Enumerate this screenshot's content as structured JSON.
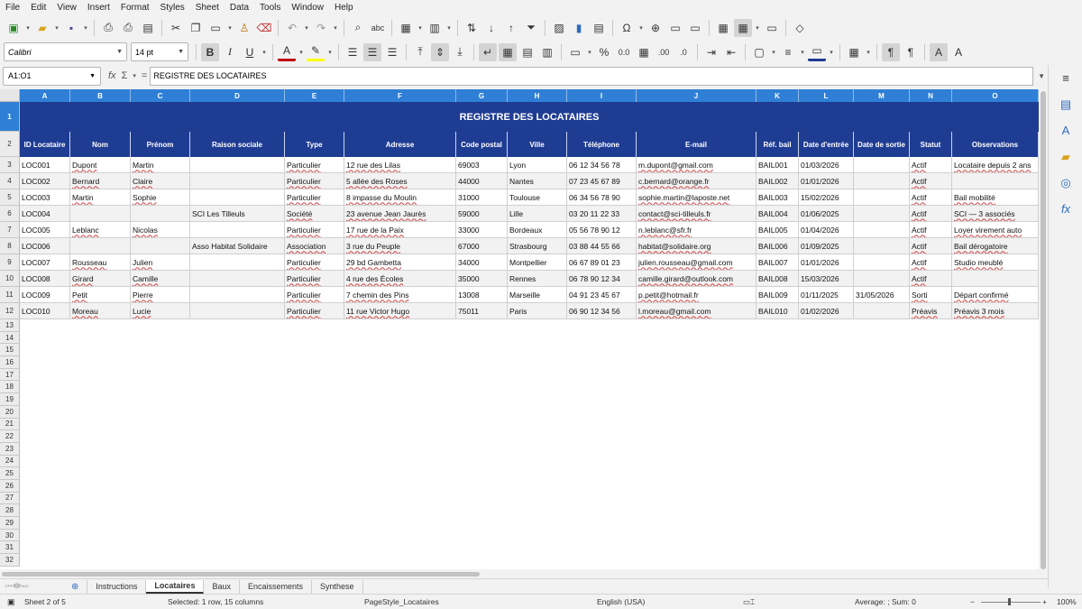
{
  "menu": [
    "File",
    "Edit",
    "View",
    "Insert",
    "Format",
    "Styles",
    "Sheet",
    "Data",
    "Tools",
    "Window",
    "Help"
  ],
  "toolbar": {
    "font_name": "Calibri",
    "font_size": "14 pt"
  },
  "formula_bar": {
    "name_box": "A1:O1",
    "fx_label": "fx",
    "sigma_label": "Σ",
    "equals_label": "=",
    "content": "REGISTRE DES LOCATAIRES"
  },
  "columns": [
    "A",
    "B",
    "C",
    "D",
    "E",
    "F",
    "G",
    "H",
    "I",
    "J",
    "K",
    "L",
    "M",
    "N",
    "O"
  ],
  "title": "REGISTRE DES LOCATAIRES",
  "headers": [
    "ID Locataire",
    "Nom",
    "Prénom",
    "Raison sociale",
    "Type",
    "Adresse",
    "Code postal",
    "Ville",
    "Téléphone",
    "E-mail",
    "Réf. bail",
    "Date d'entrée",
    "Date de sortie",
    "Statut",
    "Observations"
  ],
  "rows": [
    [
      "LOC001",
      "Dupont",
      "Martin",
      "",
      "Particulier",
      "12 rue des Lilas",
      "69003",
      "Lyon",
      "06 12 34 56 78",
      "m.dupont@gmail.com",
      "BAIL001",
      "01/03/2026",
      "",
      "Actif",
      "Locataire depuis 2 ans"
    ],
    [
      "LOC002",
      "Bernard",
      "Claire",
      "",
      "Particulier",
      "5 allée des Roses",
      "44000",
      "Nantes",
      "07 23 45 67 89",
      "c.bernard@orange.fr",
      "BAIL002",
      "01/01/2026",
      "",
      "Actif",
      ""
    ],
    [
      "LOC003",
      "Martin",
      "Sophie",
      "",
      "Particulier",
      "8 impasse du Moulin",
      "31000",
      "Toulouse",
      "06 34 56 78 90",
      "sophie.martin@laposte.net",
      "BAIL003",
      "15/02/2026",
      "",
      "Actif",
      "Bail mobilité"
    ],
    [
      "LOC004",
      "",
      "",
      "SCI Les Tilleuls",
      "Société",
      "23 avenue Jean Jaurès",
      "59000",
      "Lille",
      "03 20 11 22 33",
      "contact@sci-tilleuls.fr",
      "BAIL004",
      "01/06/2025",
      "",
      "Actif",
      "SCI — 3 associés"
    ],
    [
      "LOC005",
      "Leblanc",
      "Nicolas",
      "",
      "Particulier",
      "17 rue de la Paix",
      "33000",
      "Bordeaux",
      "05 56 78 90 12",
      "n.leblanc@sfr.fr",
      "BAIL005",
      "01/04/2026",
      "",
      "Actif",
      "Loyer virement auto"
    ],
    [
      "LOC006",
      "",
      "",
      "Asso Habitat Solidaire",
      "Association",
      "3 rue du Peuple",
      "67000",
      "Strasbourg",
      "03 88 44 55 66",
      "habitat@solidaire.org",
      "BAIL006",
      "01/09/2025",
      "",
      "Actif",
      "Bail dérogatoire"
    ],
    [
      "LOC007",
      "Rousseau",
      "Julien",
      "",
      "Particulier",
      "29 bd Gambetta",
      "34000",
      "Montpellier",
      "06 67 89 01 23",
      "julien.rousseau@gmail.com",
      "BAIL007",
      "01/01/2026",
      "",
      "Actif",
      "Studio meublé"
    ],
    [
      "LOC008",
      "Girard",
      "Camille",
      "",
      "Particulier",
      "4 rue des Écoles",
      "35000",
      "Rennes",
      "06 78 90 12 34",
      "camille.girard@outlook.com",
      "BAIL008",
      "15/03/2026",
      "",
      "Actif",
      ""
    ],
    [
      "LOC009",
      "Petit",
      "Pierre",
      "",
      "Particulier",
      "7 chemin des Pins",
      "13008",
      "Marseille",
      "04 91 23 45 67",
      "p.petit@hotmail.fr",
      "BAIL009",
      "01/11/2025",
      "31/05/2026",
      "Sorti",
      "Départ confirmé"
    ],
    [
      "LOC010",
      "Moreau",
      "Lucie",
      "",
      "Particulier",
      "11 rue Victor Hugo",
      "75011",
      "Paris",
      "06 90 12 34 56",
      "l.moreau@gmail.com",
      "BAIL010",
      "01/02/2026",
      "",
      "Préavis",
      "Préavis 3 mois"
    ]
  ],
  "row_numbers": [
    "1",
    "2",
    "3",
    "4",
    "5",
    "6",
    "7",
    "8",
    "9",
    "10",
    "11",
    "12",
    "13",
    "14",
    "15",
    "16",
    "17",
    "18",
    "19",
    "20",
    "21",
    "22",
    "23",
    "24",
    "25",
    "26",
    "27",
    "28",
    "29",
    "30",
    "31",
    "32"
  ],
  "sheet_tabs": [
    "Instructions",
    "Locataires",
    "Baux",
    "Encaissements",
    "Synthese"
  ],
  "active_tab": "Locataires",
  "status": {
    "sheet": "Sheet 2 of 5",
    "selection": "Selected: 1 row, 15 columns",
    "page_style": "PageStyle_Locataires",
    "language": "English (USA)",
    "sum": "Average: ; Sum: 0",
    "zoom": "100%"
  },
  "colors": {
    "header_blue": "#1f3c93",
    "col_header_blue": "#2f7fd6"
  }
}
